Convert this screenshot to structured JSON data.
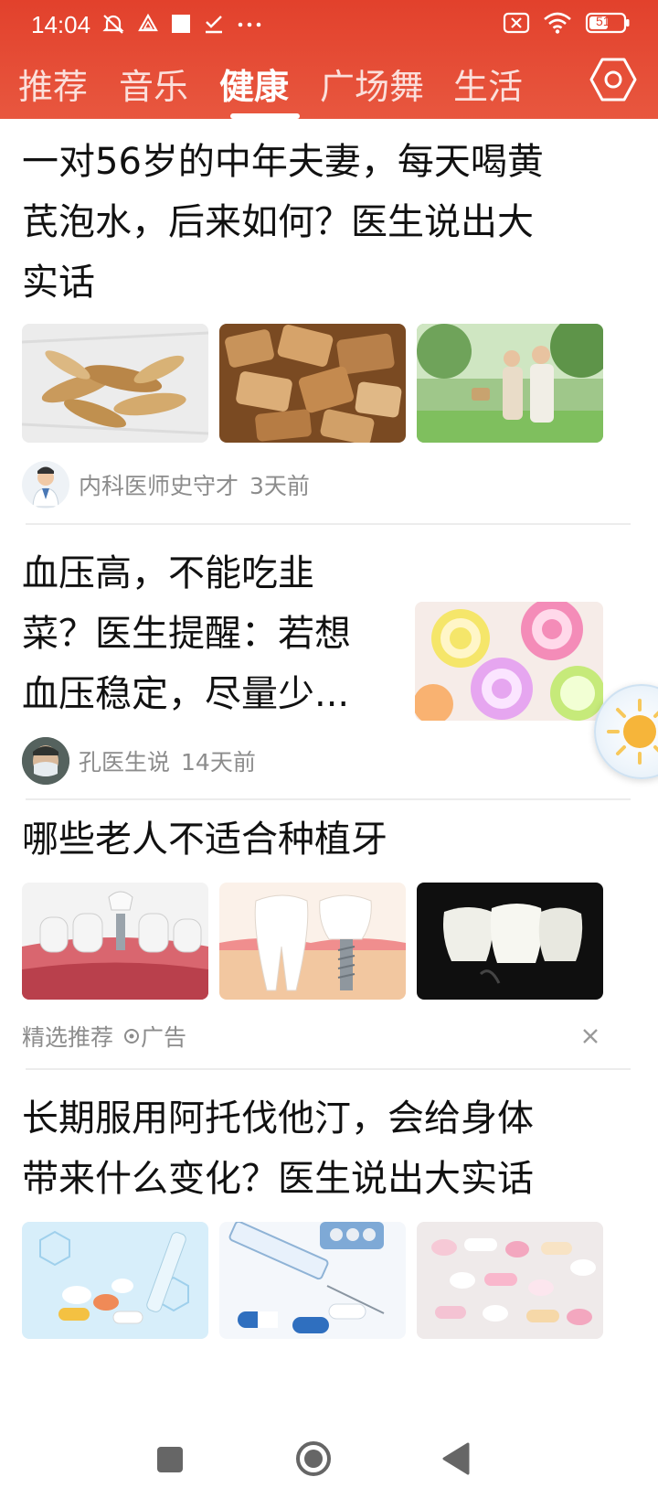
{
  "status_bar": {
    "time": "14:04",
    "battery": "51",
    "icons_left": [
      "mute-bell-icon",
      "drive-icon",
      "square-icon",
      "check-icon",
      "more-dots-icon"
    ],
    "icons_right": [
      "sim-off-icon",
      "wifi-icon",
      "battery-icon"
    ]
  },
  "tabs": [
    {
      "label": "推荐",
      "active": false
    },
    {
      "label": "音乐",
      "active": false
    },
    {
      "label": "健康",
      "active": true
    },
    {
      "label": "广场舞",
      "active": false
    },
    {
      "label": "生活",
      "active": false
    }
  ],
  "settings_icon": "hexagon-settings-icon",
  "colors": {
    "header": "#e2412c",
    "text": "#111111",
    "meta": "#8c8c8c",
    "divider": "#ececec"
  },
  "articles": [
    {
      "title_lines": [
        "一对56岁的中年夫妻，每天喝黄",
        "芪泡水，后来如何？医生说出大",
        "实话"
      ],
      "author": "内科医师史守才",
      "time": "3天前",
      "images": [
        "astragalus-slices-image",
        "astragalus-chunks-image",
        "elderly-couple-park-image"
      ]
    },
    {
      "title_lines": [
        "血压高，不能吃韭",
        "菜？医生提醒：若想",
        "血压稳定，尽量少..."
      ],
      "author": "孔医生说",
      "time": "14天前",
      "images": [
        "swirl-candies-image"
      ]
    },
    {
      "title_lines": [
        "哪些老人不适合种植牙"
      ],
      "ad_label": "精选推荐",
      "ad_tag": "广告",
      "images": [
        "dental-implant-gum-image",
        "tooth-implant-diagram-image",
        "dental-crowns-image"
      ]
    },
    {
      "title_lines": [
        "长期服用阿托伐他汀，会给身体",
        "带来什么变化？医生说出大实话"
      ],
      "images": [
        "pills-lab-image",
        "syringe-capsules-image",
        "pastel-pills-image"
      ]
    }
  ],
  "floating_button": "weather-sun-icon",
  "nav_bar": {
    "items": [
      "recent-apps-icon",
      "home-icon",
      "back-icon"
    ]
  }
}
